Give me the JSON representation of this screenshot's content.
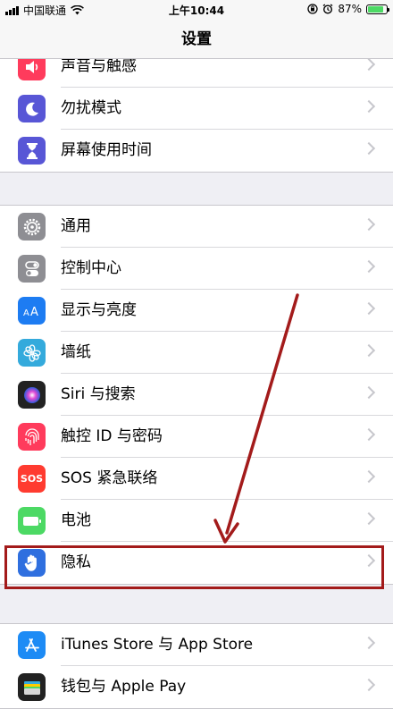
{
  "status_bar": {
    "carrier": "中国联通",
    "time": "上午10:44",
    "battery_percent_text": "87%",
    "battery_level": 0.87
  },
  "nav": {
    "title": "设置"
  },
  "groups": [
    {
      "items": [
        {
          "label": "声音与触感",
          "icon": "speaker-icon",
          "color": "#ff3b5c"
        },
        {
          "label": "勿扰模式",
          "icon": "moon-icon",
          "color": "#5856d6"
        },
        {
          "label": "屏幕使用时间",
          "icon": "hourglass-icon",
          "color": "#5856d6"
        }
      ]
    },
    {
      "items": [
        {
          "label": "通用",
          "icon": "gear-icon",
          "color": "#8e8e93"
        },
        {
          "label": "控制中心",
          "icon": "toggles-icon",
          "color": "#8e8e93"
        },
        {
          "label": "显示与亮度",
          "icon": "text-size-icon",
          "color": "#1d7cf2"
        },
        {
          "label": "墙纸",
          "icon": "flower-icon",
          "color": "#34aadc"
        },
        {
          "label": "Siri 与搜索",
          "icon": "siri-icon",
          "color": "#222222"
        },
        {
          "label": "触控 ID 与密码",
          "icon": "fingerprint-icon",
          "color": "#ff3b5c"
        },
        {
          "label": "SOS 紧急联络",
          "icon": "sos-icon",
          "color": "#ff3b30",
          "icon_text": "SOS"
        },
        {
          "label": "电池",
          "icon": "battery-icon",
          "color": "#4cd964"
        },
        {
          "label": "隐私",
          "icon": "hand-icon",
          "color": "#2f6fdf"
        }
      ]
    },
    {
      "items": [
        {
          "label": "iTunes Store 与 App Store",
          "icon": "app-store-icon",
          "color": "#1d8bf5"
        },
        {
          "label": "钱包与 Apple Pay",
          "icon": "wallet-icon",
          "color": "#222222"
        }
      ]
    }
  ],
  "accent": "#a31b1b"
}
